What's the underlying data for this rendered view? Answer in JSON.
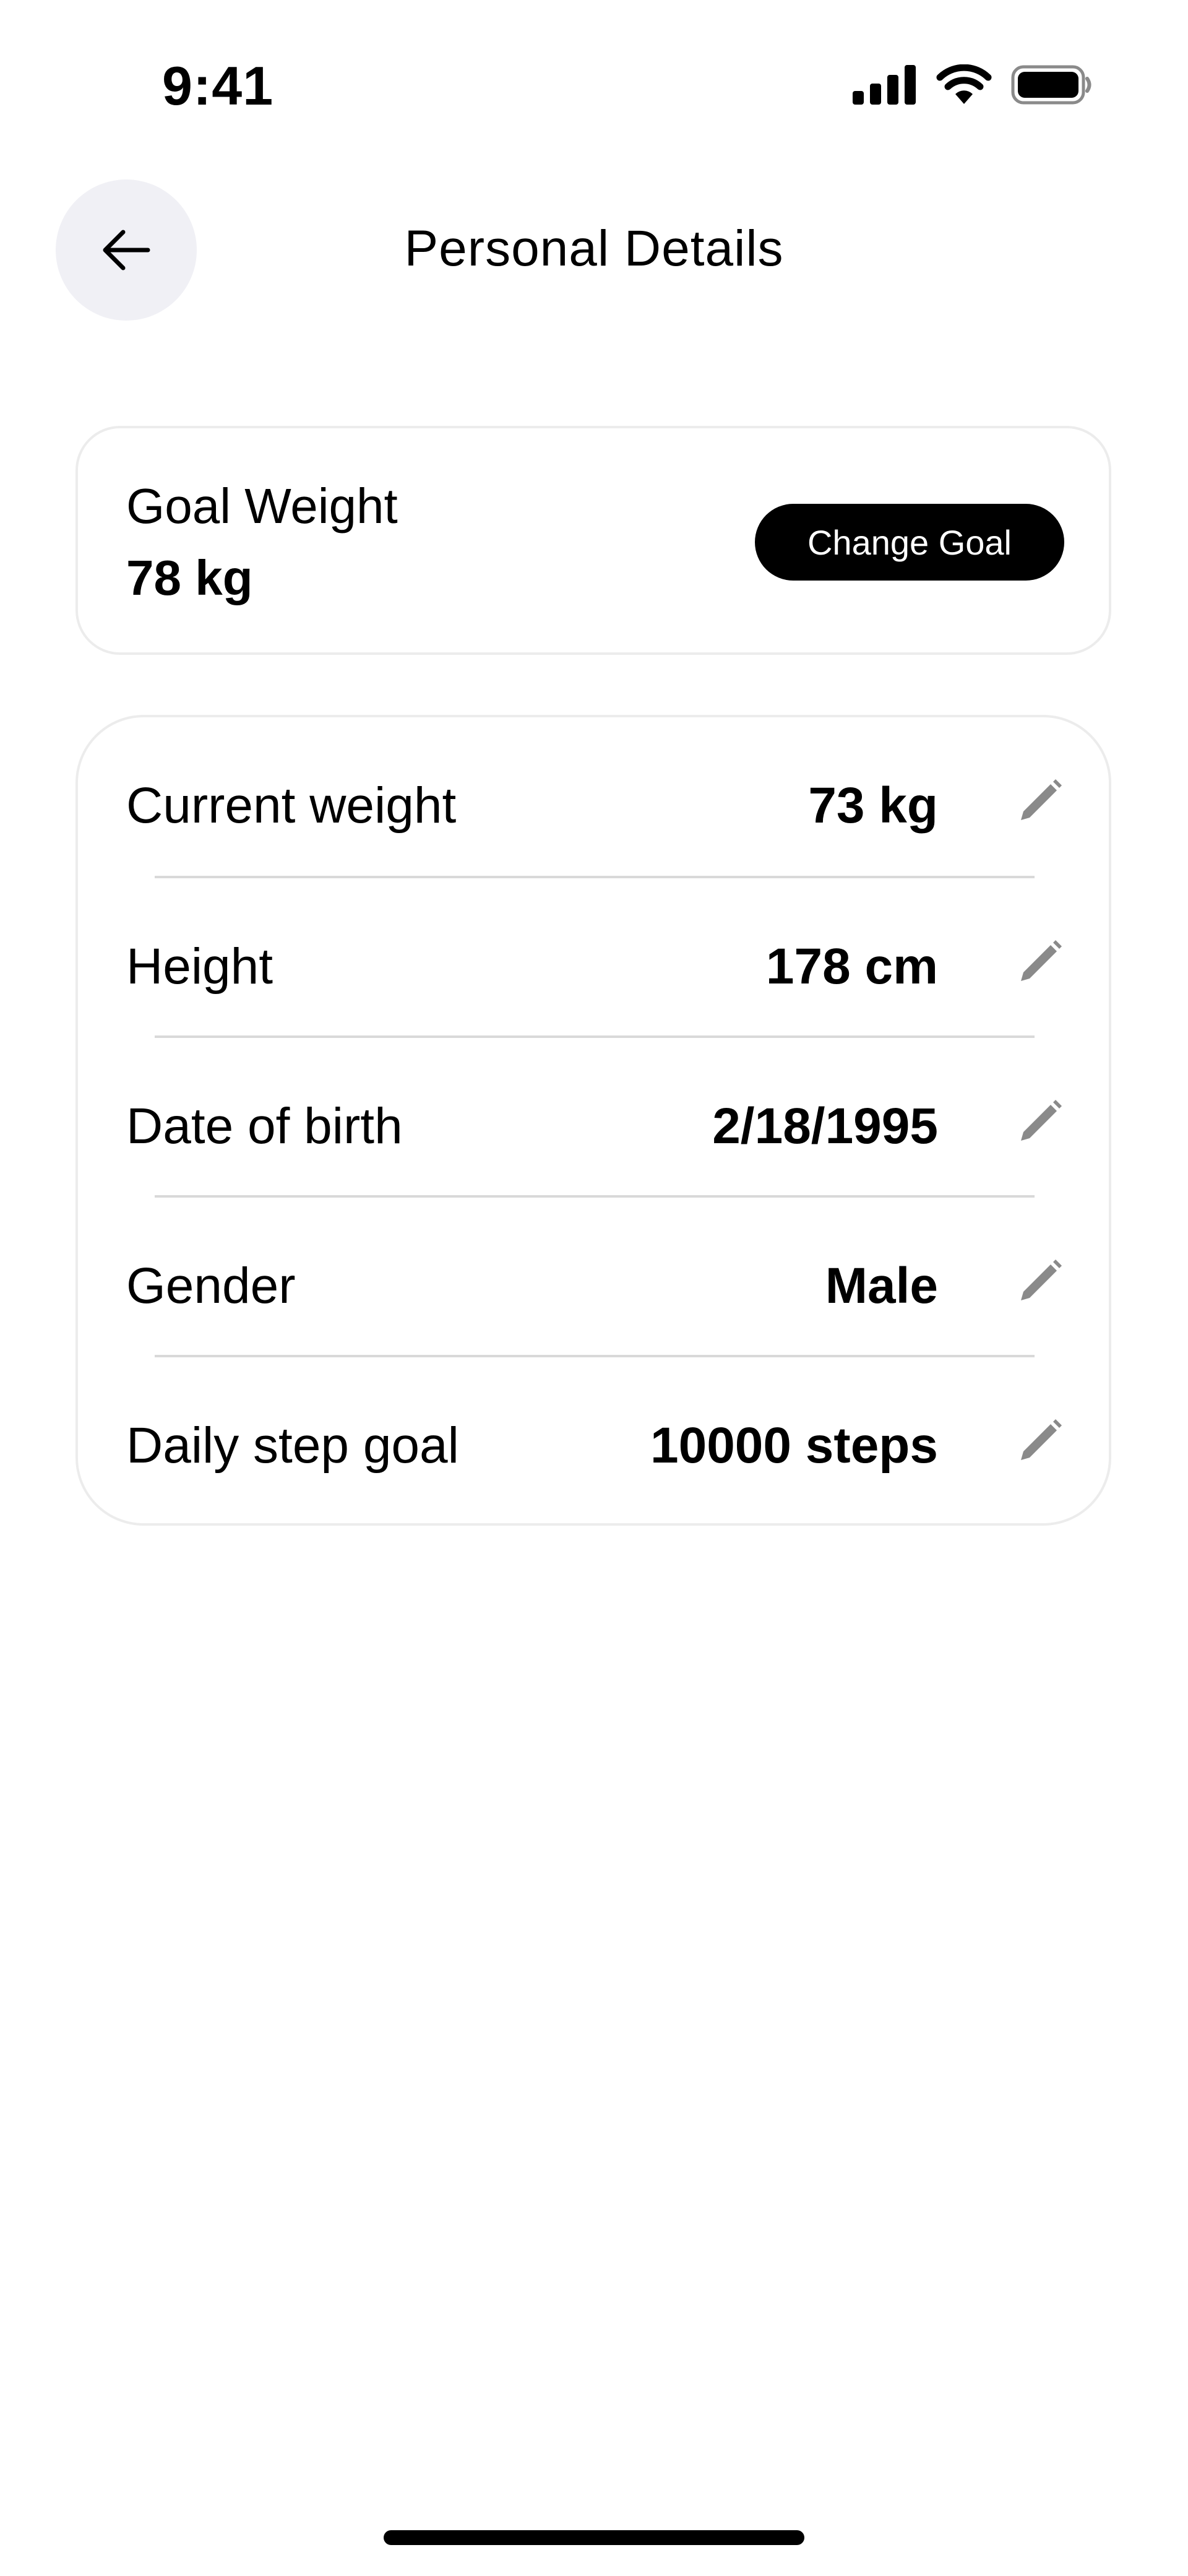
{
  "status_bar": {
    "time": "9:41"
  },
  "header": {
    "title": "Personal Details",
    "back_icon": "arrow-left-icon"
  },
  "goal": {
    "label": "Goal Weight",
    "value": "78 kg",
    "button_label": "Change Goal"
  },
  "details": [
    {
      "label": "Current weight",
      "value": "73 kg",
      "icon": "pencil-icon"
    },
    {
      "label": "Height",
      "value": "178 cm",
      "icon": "pencil-icon"
    },
    {
      "label": "Date of birth",
      "value": "2/18/1995",
      "icon": "pencil-icon"
    },
    {
      "label": "Gender",
      "value": "Male",
      "icon": "pencil-icon"
    },
    {
      "label": "Daily step goal",
      "value": "10000 steps",
      "icon": "pencil-icon"
    }
  ],
  "colors": {
    "background": "#ffffff",
    "text": "#000000",
    "back_button_bg": "#f0f0f5",
    "card_border": "#ececec",
    "divider": "#d9d9d9",
    "edit_icon": "#8a8a8a",
    "button_bg": "#000000",
    "button_text": "#ffffff"
  }
}
